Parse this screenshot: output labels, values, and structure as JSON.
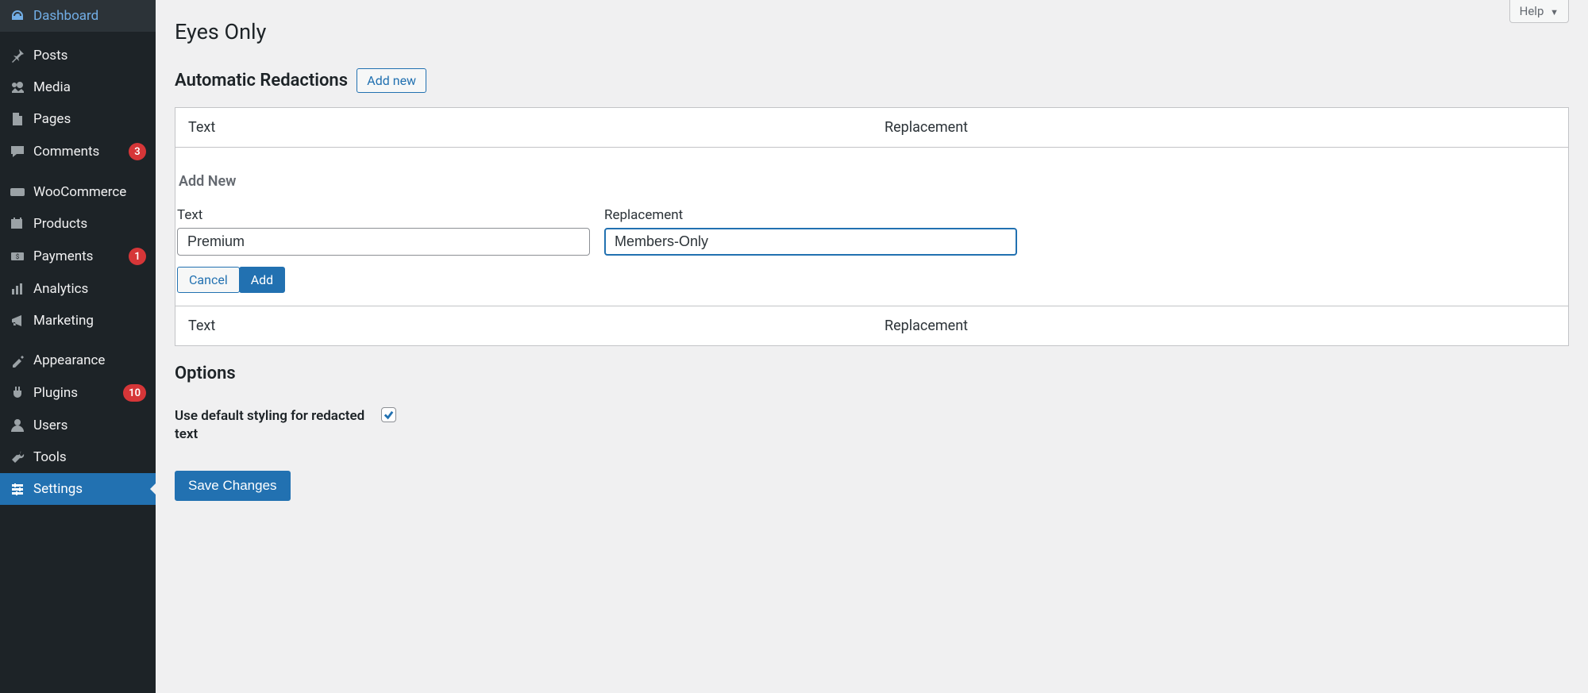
{
  "sidebar": {
    "items": [
      {
        "label": "Dashboard",
        "icon": "dashboard-icon",
        "badge": null
      },
      {
        "label": "Posts",
        "icon": "pin-icon",
        "badge": null
      },
      {
        "label": "Media",
        "icon": "media-icon",
        "badge": null
      },
      {
        "label": "Pages",
        "icon": "page-icon",
        "badge": null
      },
      {
        "label": "Comments",
        "icon": "comment-icon",
        "badge": "3"
      },
      {
        "label": "WooCommerce",
        "icon": "woo-icon",
        "badge": null
      },
      {
        "label": "Products",
        "icon": "product-icon",
        "badge": null
      },
      {
        "label": "Payments",
        "icon": "payment-icon",
        "badge": "1"
      },
      {
        "label": "Analytics",
        "icon": "analytics-icon",
        "badge": null
      },
      {
        "label": "Marketing",
        "icon": "marketing-icon",
        "badge": null
      },
      {
        "label": "Appearance",
        "icon": "appearance-icon",
        "badge": null
      },
      {
        "label": "Plugins",
        "icon": "plugin-icon",
        "badge": "10"
      },
      {
        "label": "Users",
        "icon": "user-icon",
        "badge": null
      },
      {
        "label": "Tools",
        "icon": "tool-icon",
        "badge": null
      },
      {
        "label": "Settings",
        "icon": "settings-icon",
        "badge": null,
        "active": true
      }
    ]
  },
  "header": {
    "help_label": "Help",
    "page_title": "Eyes Only"
  },
  "redactions": {
    "section_title": "Automatic Redactions",
    "add_new_link": "Add new",
    "table": {
      "col_text": "Text",
      "col_replacement": "Replacement"
    },
    "add_form": {
      "heading": "Add New",
      "text_label": "Text",
      "text_value": "Premium",
      "replacement_label": "Replacement",
      "replacement_value": "Members-Only",
      "cancel_label": "Cancel",
      "add_label": "Add"
    }
  },
  "options": {
    "section_title": "Options",
    "default_styling_label": "Use default styling for redacted text",
    "default_styling_checked": true
  },
  "save_label": "Save Changes"
}
